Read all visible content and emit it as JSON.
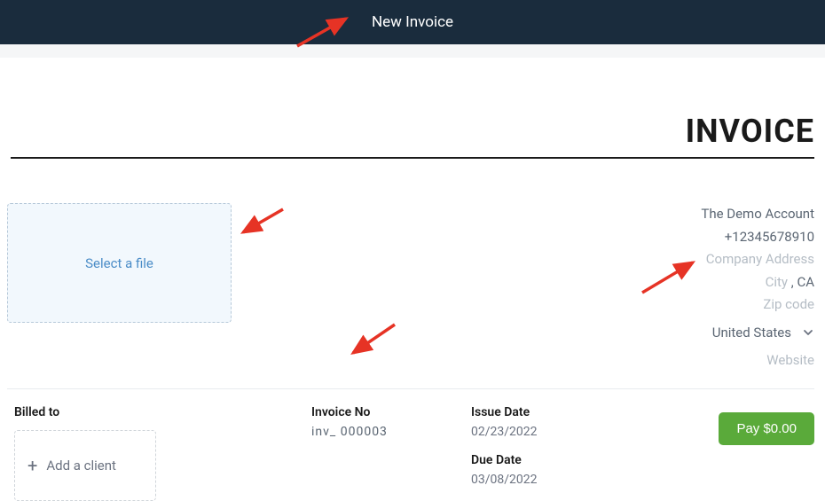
{
  "header": {
    "title": "New Invoice"
  },
  "invoice": {
    "title": "INVOICE",
    "file_select_label": "Select a file",
    "company": {
      "name": "The Demo Account",
      "phone": "+12345678910",
      "address_placeholder": "Company Address",
      "city_placeholder": "City",
      "state": "CA",
      "zip_placeholder": "Zip code",
      "country": "United States",
      "website_placeholder": "Website",
      "separator": ","
    },
    "billed_to_label": "Billed to",
    "add_client_label": "Add a client",
    "invoice_no_label": "Invoice No",
    "invoice_prefix": "inv_",
    "invoice_number": "000003",
    "issue_date_label": "Issue Date",
    "issue_date": "02/23/2022",
    "due_date_label": "Due Date",
    "due_date": "03/08/2022",
    "pay_button": "Pay $0.00"
  }
}
